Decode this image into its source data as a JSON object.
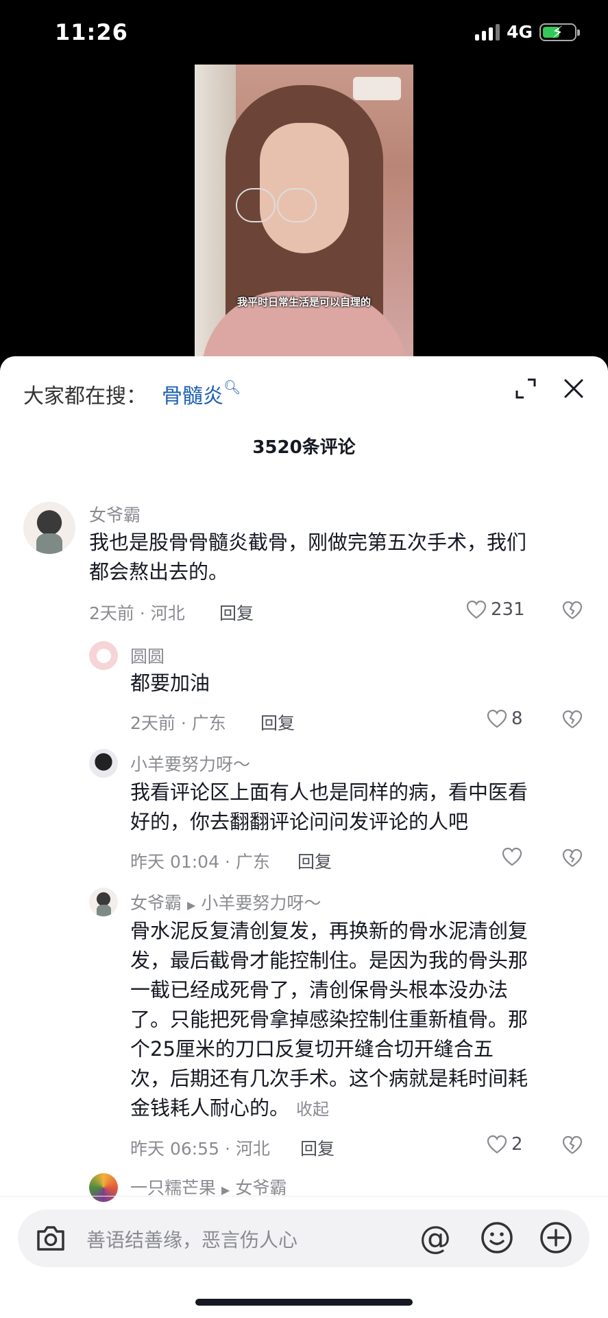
{
  "status": {
    "time": "11:26",
    "network": "4G"
  },
  "video": {
    "caption": "我平时日常生活是可以自理的"
  },
  "header": {
    "search_label": "大家都在搜：",
    "search_term": "骨髓炎",
    "comment_count": "3520条评论"
  },
  "comments": [
    {
      "user": "女爷霸",
      "text_lines": [
        "我也是股骨骨髓炎截骨，刚做完第五次手术，我们",
        "都会熬出去的。"
      ],
      "meta": "2天前 · 河北",
      "reply": "回复",
      "likes": "231"
    },
    {
      "user": "圆圆",
      "text_lines": [
        "都要加油"
      ],
      "meta": "2天前 · 广东",
      "reply": "回复",
      "likes": "8"
    },
    {
      "user": "小羊要努力呀～",
      "text_lines": [
        "我看评论区上面有人也是同样的病，看中医看",
        "好的，你去翻翻评论问问发评论的人吧"
      ],
      "meta": "昨天 01:04 · 广东",
      "reply": "回复",
      "likes": ""
    },
    {
      "user": "女爷霸",
      "reply_to": "小羊要努力呀～",
      "text_lines": [
        "骨水泥反复清创复发，再换新的骨水泥清创复",
        "发，最后截骨才能控制住。是因为我的骨头那",
        "一截已经成死骨了，清创保骨头根本没办法",
        "了。只能把死骨拿掉感染控制住重新植骨。那",
        "个25厘米的刀口反复切开缝合切开缝合五",
        "次，后期还有几次手术。这个病就是耗时间耗",
        "金钱耗人耐心的。"
      ],
      "collapse": "收起",
      "meta": "昨天 06:55 · 河北",
      "reply": "回复",
      "likes": "2"
    },
    {
      "user": "一只糯芒果",
      "reply_to": "女爷霸"
    }
  ],
  "input": {
    "placeholder": "善语结善缘，恶言伤人心"
  },
  "colors": {
    "link": "#1a5fb4",
    "muted": "#8a8b91",
    "text": "#161823"
  }
}
